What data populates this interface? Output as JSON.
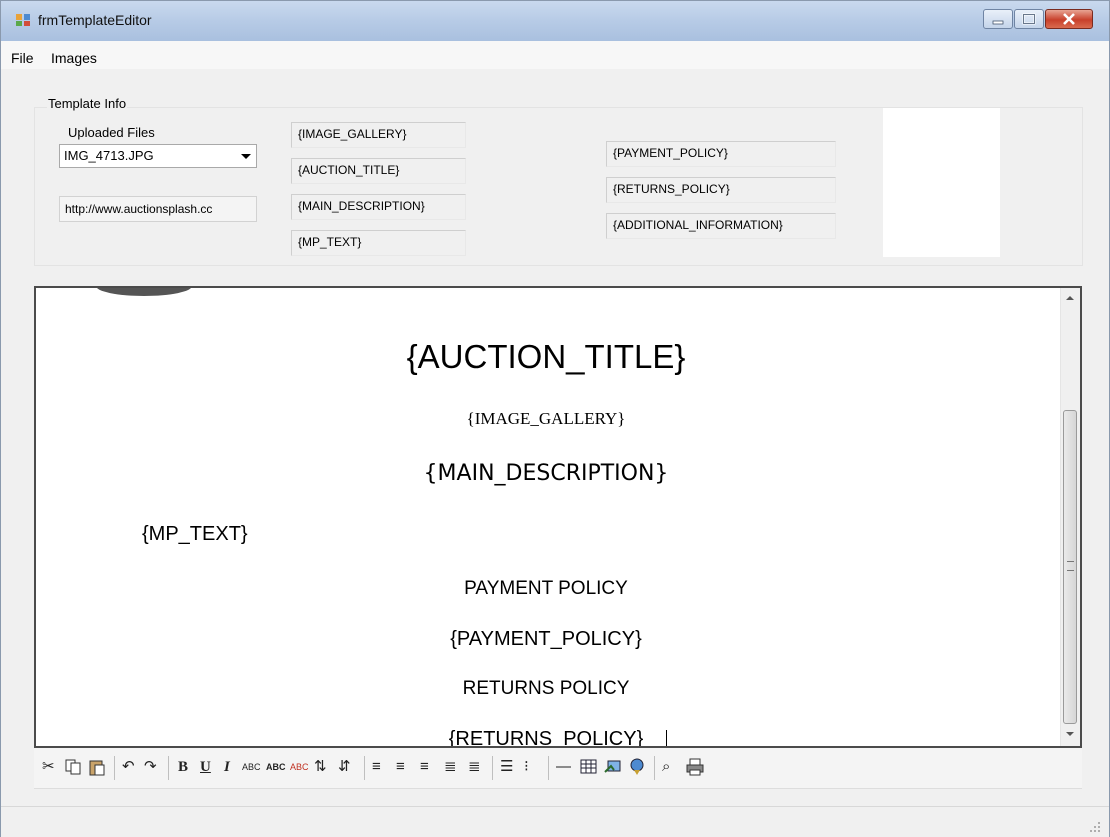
{
  "window": {
    "title": "frmTemplateEditor"
  },
  "menu": {
    "file": "File",
    "images": "Images"
  },
  "template_info": {
    "group_label": "Template Info",
    "uploaded_files_label": "Uploaded Files",
    "selected_file": "IMG_4713.JPG",
    "url": "http://www.auctionsplash.cc",
    "tokens_left": [
      "{IMAGE_GALLERY}",
      "{AUCTION_TITLE}",
      "{MAIN_DESCRIPTION}",
      "{MP_TEXT}"
    ],
    "tokens_right": [
      "{PAYMENT_POLICY}",
      "{RETURNS_POLICY}",
      "{ADDITIONAL_INFORMATION}"
    ]
  },
  "editor": {
    "auction_title": "{AUCTION_TITLE}",
    "image_gallery": "{IMAGE_GALLERY}",
    "main_description": "{MAIN_DESCRIPTION}",
    "mp_text": "{MP_TEXT}",
    "payment_heading": "PAYMENT POLICY",
    "payment_token": "{PAYMENT_POLICY}",
    "returns_heading": "RETURNS POLICY",
    "returns_token": "{RETURNS_POLICY}"
  },
  "toolbar": {
    "bold": "B",
    "underline": "U",
    "italic": "I",
    "small_caps_1": "ABC",
    "small_caps_2": "ABC",
    "small_caps_3": "ABC"
  },
  "icons": {
    "cut": "cut-icon",
    "copy": "copy-icon",
    "paste": "paste-icon",
    "undo": "undo-icon",
    "redo": "redo-icon",
    "sort_asc": "sort-ascending-icon",
    "sort_desc": "sort-descending-icon",
    "align_left": "align-left-icon",
    "align_center": "align-center-icon",
    "align_right": "align-right-icon",
    "indent": "indent-icon",
    "outdent": "outdent-icon",
    "bullets": "bullet-list-icon",
    "numbering": "numbered-list-icon",
    "hr": "horizontal-rule-icon",
    "table": "table-icon",
    "image": "insert-image-icon",
    "link": "hyperlink-icon",
    "find": "find-icon",
    "print": "print-icon"
  },
  "colors": {
    "titlebar": "#b7cbe6",
    "close_button": "#c8402b",
    "window_bg": "#f0f0f0"
  }
}
